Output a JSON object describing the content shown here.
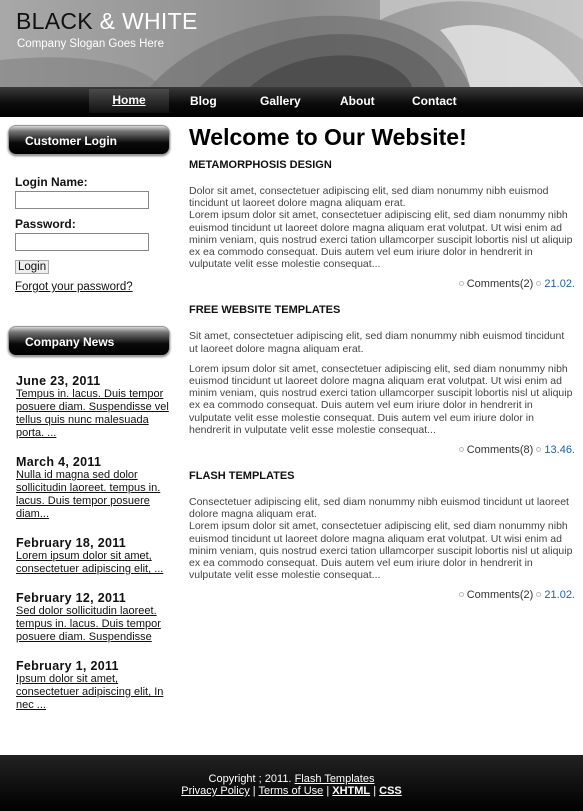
{
  "header": {
    "brand_black": "BLACK",
    "brand_amp": "&",
    "brand_white": "WHITE",
    "slogan": "Company Slogan Goes Here"
  },
  "nav": {
    "items": [
      "Home",
      "Blog",
      "Gallery",
      "About",
      "Contact"
    ]
  },
  "sidebar": {
    "login_title": "Customer Login",
    "login_name_label": "Login Name:",
    "password_label": "Password:",
    "login_button": "Login",
    "forgot_link": "Forgot your password?",
    "news_title": "Company News",
    "news": [
      {
        "date": "June 23, 2011",
        "text": "Tempus in. lacus. Duis tempor posuere diam. Suspendisse vel tellus quis nunc malesuada porta. ..."
      },
      {
        "date": "March 4, 2011",
        "text": "Nulla id magna sed dolor sollicitudin laoreet. tempus in. lacus. Duis tempor posuere diam..."
      },
      {
        "date": "February 18, 2011",
        "text": "Lorem ipsum dolor sit amet, consectetuer adipiscing elit, ..."
      },
      {
        "date": "February 12, 2011",
        "text": "Sed dolor sollicitudin laoreet. tempus in. lacus. Duis tempor posuere diam. Suspendisse"
      },
      {
        "date": "February 1, 2011",
        "text": "Ipsum dolor sit amet, consectetuer adipiscing elit, In nec ..."
      }
    ]
  },
  "main": {
    "heading": "Welcome to Our Website!",
    "articles": [
      {
        "title": "METAMORPHOSIS DESIGN",
        "p1": "Dolor sit amet, consectetuer adipiscing elit, sed diam nonummy nibh euismod tincidunt ut laoreet dolore magna aliquam erat.",
        "p2": "Lorem ipsum dolor sit amet, consectetuer adipiscing elit, sed diam nonummy nibh euismod tincidunt ut laoreet dolore magna aliquam erat volutpat. Ut wisi enim ad minim veniam, quis nostrud exerci tation ullamcorper suscipit lobortis nisl ut aliquip ex ea commodo consequat. Duis autem vel eum iriure dolor in hendrerit in vulputate velit esse molestie consequat...",
        "comments": "Comments(2)",
        "time": "21.02."
      },
      {
        "title": "FREE WEBSITE TEMPLATES",
        "p1": "Sit amet, consectetuer adipiscing elit, sed diam nonummy nibh euismod tincidunt ut laoreet dolore magna aliquam erat.",
        "p2": "Lorem ipsum dolor sit amet, consectetuer adipiscing elit, sed diam nonummy nibh euismod tincidunt ut laoreet dolore magna aliquam erat volutpat. Ut wisi enim ad minim veniam, quis nostrud exerci tation ullamcorper suscipit lobortis nisl ut aliquip ex ea commodo consequat. Duis autem vel eum iriure dolor in hendrerit in vulputate velit esse molestie consequat. Duis autem vel eum iriure dolor in hendrerit in vulputate velit esse molestie consequat...",
        "comments": "Comments(8)",
        "time": "13.46."
      },
      {
        "title": "FLASH TEMPLATES",
        "p1": "Consectetuer adipiscing elit, sed diam nonummy nibh euismod tincidunt ut laoreet dolore magna aliquam erat.",
        "p2": "Lorem ipsum dolor sit amet, consectetuer adipiscing elit, sed diam nonummy nibh euismod tincidunt ut laoreet dolore magna aliquam erat volutpat. Ut wisi enim ad minim veniam, quis nostrud exerci tation ullamcorper suscipit lobortis nisl ut aliquip ex ea commodo consequat. Duis autem vel eum iriure dolor in hendrerit in vulputate velit esse molestie consequat...",
        "comments": "Comments(2)",
        "time": "21.02."
      }
    ]
  },
  "footer": {
    "copyright": "Copyright ; 2011.",
    "flash_link": "Flash Templates",
    "privacy": "Privacy Policy",
    "sep": "|",
    "terms": "Terms of Use",
    "xhtml": "XHTML",
    "css": "CSS"
  }
}
